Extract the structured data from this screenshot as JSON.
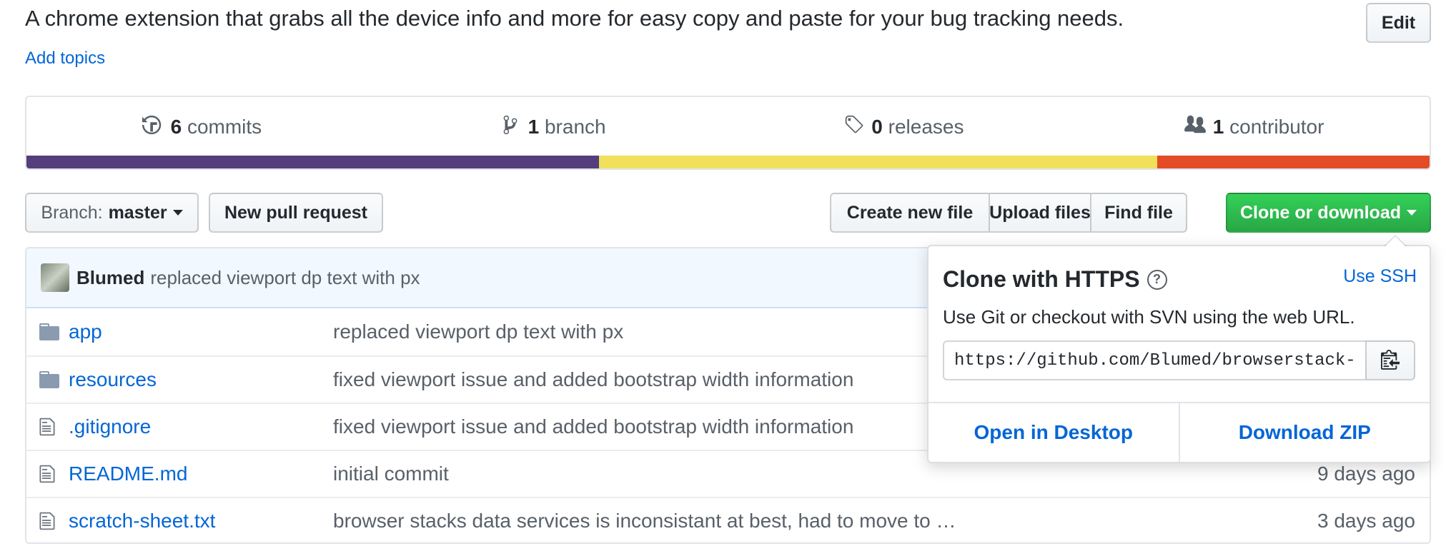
{
  "repo": {
    "description": "A chrome extension that grabs all the device info and more for easy copy and paste for your bug tracking needs.",
    "add_topics": "Add topics",
    "edit_label": "Edit"
  },
  "summary": {
    "commits": {
      "count": "6",
      "label": "commits",
      "icon": "history-icon"
    },
    "branches": {
      "count": "1",
      "label": "branch",
      "icon": "git-branch-icon"
    },
    "releases": {
      "count": "0",
      "label": "releases",
      "icon": "tag-icon"
    },
    "contributors": {
      "count": "1",
      "label": "contributor",
      "icon": "people-icon"
    },
    "languages": [
      {
        "color": "#563d7c",
        "fraction": 0.408
      },
      {
        "color": "#f1e05a",
        "fraction": 0.398
      },
      {
        "color": "#e34c26",
        "fraction": 0.194
      }
    ]
  },
  "toolbar": {
    "branch_prefix": "Branch:",
    "branch_name": "master",
    "new_pr": "New pull request",
    "create_file": "Create new file",
    "upload_files": "Upload files",
    "find_file": "Find file",
    "clone_download": "Clone or download"
  },
  "latest_commit": {
    "author": "Blumed",
    "message": "replaced viewport dp text with px"
  },
  "files": [
    {
      "type": "directory",
      "name": "app",
      "message": "replaced viewport dp text with px",
      "age": ""
    },
    {
      "type": "directory",
      "name": "resources",
      "message": "fixed viewport issue and added bootstrap width information",
      "age": ""
    },
    {
      "type": "file",
      "name": ".gitignore",
      "message": "fixed viewport issue and added bootstrap width information",
      "age": ""
    },
    {
      "type": "file",
      "name": "README.md",
      "message": "initial commit",
      "age": "9 days ago"
    },
    {
      "type": "file",
      "name": "scratch-sheet.txt",
      "message": "browser stacks data services is inconsistant at best, had to move to …",
      "age": "3 days ago"
    }
  ],
  "clone_popover": {
    "title": "Clone with HTTPS",
    "help_glyph": "?",
    "use_ssh": "Use SSH",
    "description": "Use Git or checkout with SVN using the web URL.",
    "url": "https://github.com/Blumed/browserstack-",
    "open_desktop": "Open in Desktop",
    "download_zip": "Download ZIP"
  }
}
